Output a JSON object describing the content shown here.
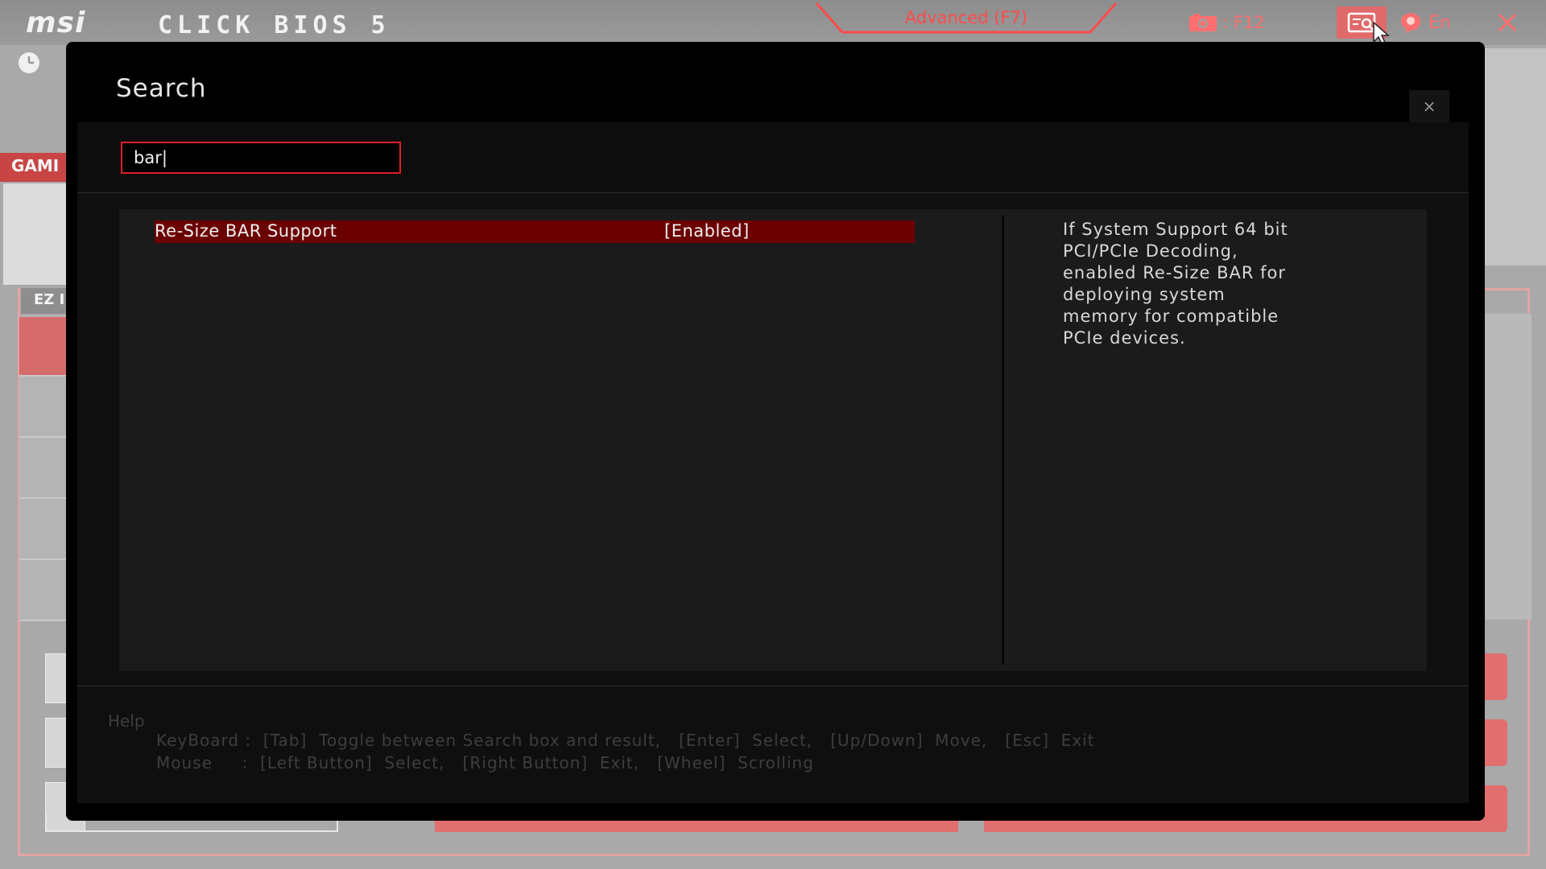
{
  "header": {
    "brand": "msi",
    "product": "CLICK BIOS 5",
    "mode_tab": "Advanced (F7)",
    "screenshot_key": "F12",
    "language": "En"
  },
  "background": {
    "game_boost": "GAMI",
    "ez_mode": "EZ I"
  },
  "modal": {
    "title": "Search",
    "close_label": "×",
    "search_value": "bar|",
    "results": [
      {
        "name": "Re-Size BAR Support",
        "value": "[Enabled]"
      }
    ],
    "description": "If System Support 64 bit PCI/PCIe Decoding, enabled Re-Size BAR for deploying system memory for compatible PCIe devices.",
    "help": {
      "title": "Help",
      "keyboard": "KeyBoard :  [Tab]  Toggle between Search box and result,   [Enter]  Select,   [Up/Down]  Move,   [Esc]  Exit",
      "mouse": "Mouse     :  [Left Button]  Select,   [Right Button]  Exit,   [Wheel]  Scrolling"
    }
  },
  "colors": {
    "accent": "#e02020",
    "selected_row": "#6b0000",
    "tab_text": "#ff4b4b"
  },
  "icons": [
    "camera-icon",
    "search-icon",
    "globe-icon",
    "close-icon",
    "clock-icon",
    "mouse-cursor-icon"
  ]
}
